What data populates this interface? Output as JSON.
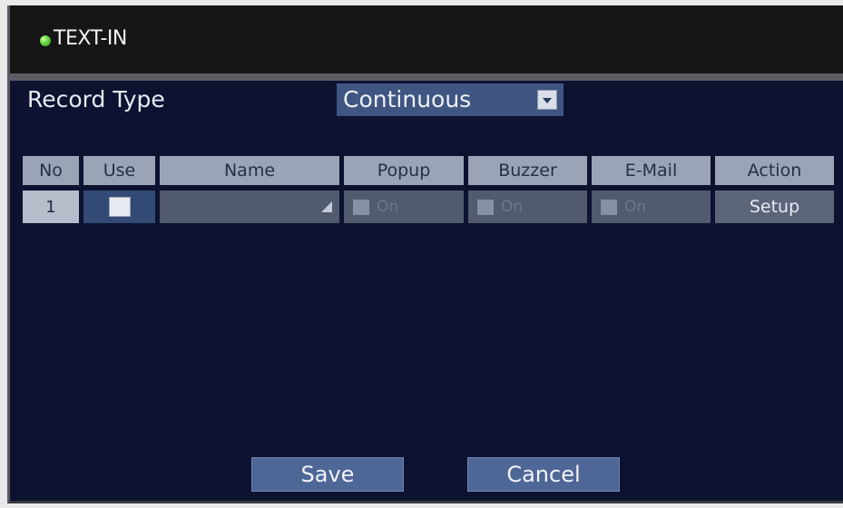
{
  "window": {
    "title": "TEXT-IN"
  },
  "record_type": {
    "label": "Record Type",
    "value": "Continuous"
  },
  "table": {
    "headers": [
      "No",
      "Use",
      "Name",
      "Popup",
      "Buzzer",
      "E-Mail",
      "Action"
    ],
    "rows": [
      {
        "no": "1",
        "use_checked": false,
        "name": "",
        "popup": "On",
        "buzzer": "On",
        "email": "On",
        "action": "Setup"
      }
    ]
  },
  "buttons": {
    "save": "Save",
    "cancel": "Cancel"
  },
  "colors": {
    "background": "#0c1230",
    "header_cell": "#9ba3b6",
    "accent": "#4f6797",
    "status_led": "#6ee04a"
  },
  "icons": {
    "status": "status-led-icon",
    "dropdown": "dropdown-arrow-icon",
    "name_edit": "resize-icon"
  }
}
